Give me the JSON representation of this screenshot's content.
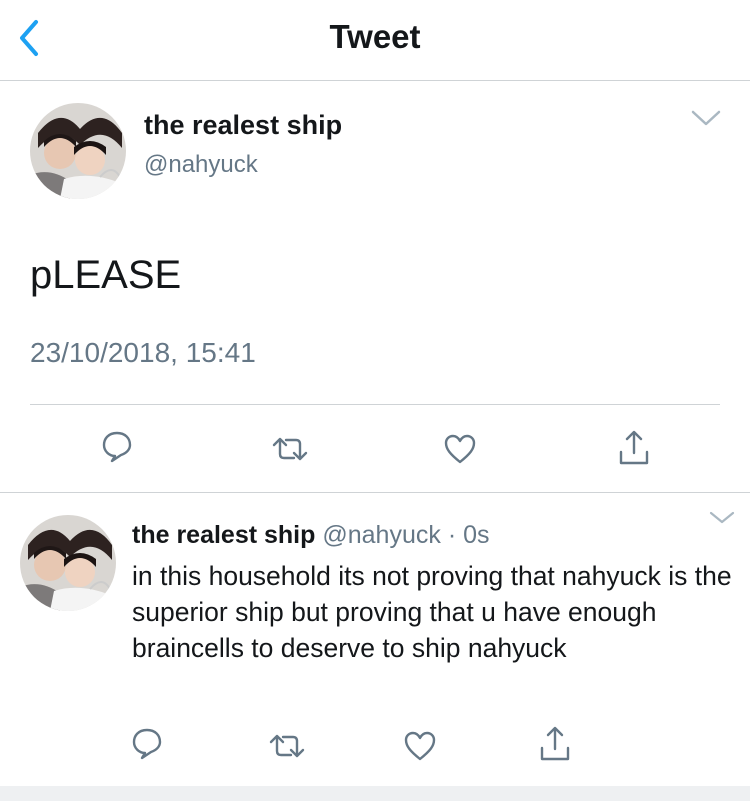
{
  "nav": {
    "title": "Tweet",
    "back_icon": "chevron-left-icon"
  },
  "colors": {
    "accent": "#1da1f2",
    "text": "#14171a",
    "secondary": "#657786",
    "divider": "#cfd3d6"
  },
  "main_tweet": {
    "display_name": "the realest ship",
    "handle": "@nahyuck",
    "text": "pLEASE",
    "timestamp": "23/10/2018, 15:41",
    "actions": [
      "reply-icon",
      "retweet-icon",
      "like-icon",
      "share-icon"
    ]
  },
  "reply_tweet": {
    "display_name": "the realest ship",
    "handle": "@nahyuck",
    "separator": "·",
    "age": "0s",
    "text": "in this household its not proving that nahyuck is the superior ship but proving that u have enough braincells to deserve to ship nahyuck",
    "actions": [
      "reply-icon",
      "retweet-icon",
      "like-icon",
      "share-icon"
    ]
  }
}
